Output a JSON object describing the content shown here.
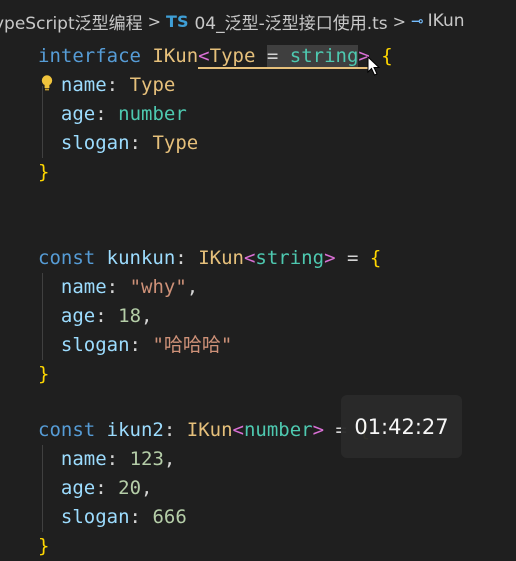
{
  "breadcrumb": {
    "folder": "ypeScript泛型编程",
    "ts_badge": "TS",
    "file": "04_泛型-泛型接口使用.ts",
    "symbol": "IKun",
    "separator": ">"
  },
  "code": {
    "line1": {
      "kw": "interface",
      "name": "IKun",
      "lt": "<",
      "param": "Type",
      "eq": "=",
      "def": "string",
      "gt": ">",
      "open": "{"
    },
    "line2": {
      "prop": "name",
      "colon": ":",
      "type": "Type"
    },
    "line3": {
      "prop": "age",
      "colon": ":",
      "type": "number"
    },
    "line4": {
      "prop": "slogan",
      "colon": ":",
      "type": "Type"
    },
    "line5": {
      "close": "}"
    },
    "line8": {
      "kw": "const",
      "var": "kunkun",
      "colon": ":",
      "type": "IKun",
      "lt": "<",
      "arg": "string",
      "gt": ">",
      "eq": "=",
      "open": "{"
    },
    "line9": {
      "prop": "name",
      "colon": ":",
      "value": "\"why\"",
      "comma": ","
    },
    "line10": {
      "prop": "age",
      "colon": ":",
      "value": "18",
      "comma": ","
    },
    "line11": {
      "prop": "slogan",
      "colon": ":",
      "value": "\"哈哈哈\""
    },
    "line12": {
      "close": "}"
    },
    "line14": {
      "kw": "const",
      "var": "ikun2",
      "colon": ":",
      "type": "IKun",
      "lt": "<",
      "arg": "number",
      "gt": ">",
      "eq": "=",
      "open": "{"
    },
    "line15": {
      "prop": "name",
      "colon": ":",
      "value": "123",
      "comma": ","
    },
    "line16": {
      "prop": "age",
      "colon": ":",
      "value": "20",
      "comma": ","
    },
    "line17": {
      "prop": "slogan",
      "colon": ":",
      "value": "666"
    },
    "line18": {
      "close": "}"
    }
  },
  "timer": {
    "text": "01:42:27"
  },
  "icons": {
    "bulb": "lightbulb-icon",
    "cursor": "mouse-cursor-icon",
    "interface": "interface-symbol-icon"
  },
  "colors": {
    "background": "#1f1f1f",
    "keyword": "#c586c0",
    "const": "#569cd6",
    "type": "#e6c07b",
    "string": "#ce9178",
    "number": "#b5cea8"
  }
}
